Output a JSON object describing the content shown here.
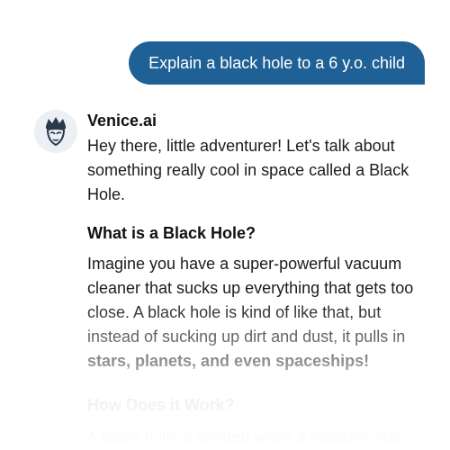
{
  "conversation": {
    "user_message": "Explain a black hole to a 6 y.o. child",
    "assistant": {
      "name": "Venice.ai",
      "intro": "Hey there, little adventurer! Let's talk about something really cool in space called a Black Hole.",
      "section1": {
        "heading": "What is a Black Hole?",
        "body_before": "Imagine you have a super-powerful vacuum cleaner that sucks up everything that gets too close. A black hole is kind of like that, but instead of sucking up dirt and dust, it pulls in ",
        "body_strong": "stars, planets, and even spaceships!"
      },
      "section2": {
        "heading": "How Does it Work?",
        "body": "A black hole is created when a massive star"
      }
    }
  },
  "colors": {
    "user_bubble": "#1f6196",
    "avatar_bg": "#ecf0f5"
  },
  "icons": {
    "avatar": "venice-logo-icon"
  }
}
